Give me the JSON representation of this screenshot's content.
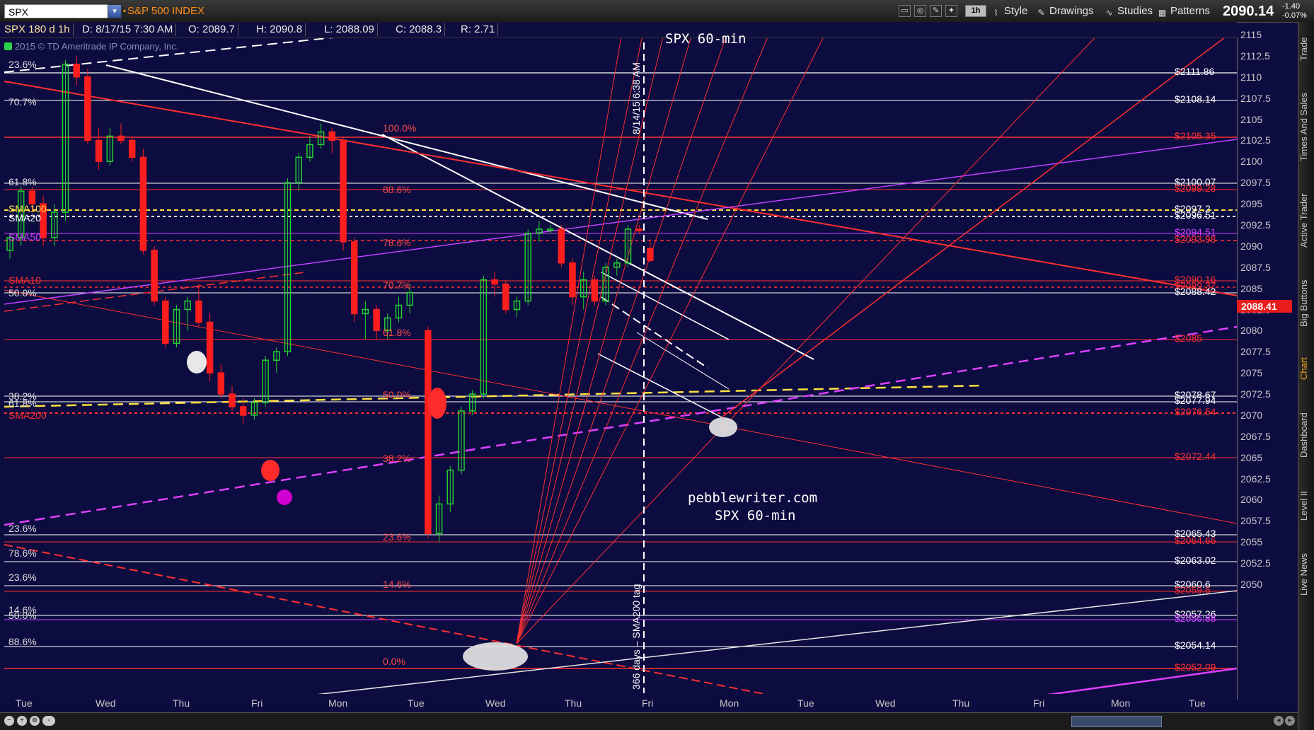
{
  "toolbar": {
    "symbol": "SPX",
    "index_name": "S&P 500 INDEX",
    "timeframe": "1h",
    "style_label": "Style",
    "drawings_label": "Drawings",
    "studies_label": "Studies",
    "patterns_label": "Patterns",
    "last_price": "2090.14",
    "net_change": "-1.40",
    "pct_change": "-0.07%"
  },
  "infobar": {
    "title": "SPX 180 d 1h",
    "date": "D: 8/17/15 7:30 AM",
    "open": "O: 2089.7",
    "high": "H: 2090.8",
    "low": "L: 2088.09",
    "close": "C: 2088.3",
    "range": "R: 2.71"
  },
  "copyright": "2015 © TD Ameritrade IP Company, Inc.",
  "price_axis": {
    "ticks": [
      "2115",
      "2112.5",
      "2110",
      "2107.5",
      "2105",
      "2102.5",
      "2100",
      "2097.5",
      "2095",
      "2092.5",
      "2090",
      "2087.5",
      "2085",
      "2082.5",
      "2080",
      "2077.5",
      "2075",
      "2072.5",
      "2070",
      "2067.5",
      "2065",
      "2062.5",
      "2060",
      "2057.5",
      "2055",
      "2052.5",
      "2050"
    ],
    "current_price": "2088.41"
  },
  "levels": [
    {
      "label": "$2111.86",
      "color": "#ffffff"
    },
    {
      "label": "$2108.14",
      "color": "#ffffff"
    },
    {
      "label": "$2105.35",
      "color": "#ff3030"
    },
    {
      "label": "$2100.07",
      "color": "#ffffff"
    },
    {
      "label": "$2099.28",
      "color": "#ff3030"
    },
    {
      "label": "$2097.2",
      "color": "#ffffff"
    },
    {
      "label": "$2096.51",
      "color": "#ffffff"
    },
    {
      "label": "$2094.51",
      "color": "#d040ff"
    },
    {
      "label": "$2093.98",
      "color": "#ff3030"
    },
    {
      "label": "$2090.16",
      "color": "#ff3030"
    },
    {
      "label": "$2089.37",
      "color": "#ff3030"
    },
    {
      "label": "$2088.42",
      "color": "#ffffff"
    },
    {
      "label": "$2085",
      "color": "#ff3030"
    },
    {
      "label": "$2078.67",
      "color": "#ffffff"
    },
    {
      "label": "$2077.94",
      "color": "#ffffff"
    },
    {
      "label": "$2076.54",
      "color": "#ff3030"
    },
    {
      "label": "$2072.44",
      "color": "#ff3030"
    },
    {
      "label": "$2065.43",
      "color": "#ffffff"
    },
    {
      "label": "$2064.66",
      "color": "#ff3030"
    },
    {
      "label": "$2063.02",
      "color": "#ffffff"
    },
    {
      "label": "$2060.6",
      "color": "#ffffff"
    },
    {
      "label": "$2059.6",
      "color": "#ff3030"
    },
    {
      "label": "$2057.26",
      "color": "#ffffff"
    },
    {
      "label": "$2056.88",
      "color": "#d040ff"
    },
    {
      "label": "$2054.14",
      "color": "#ffffff"
    },
    {
      "label": "$2052.09",
      "color": "#ff3030"
    }
  ],
  "fib_left": [
    "23.6%",
    "70.7%",
    "61.8%",
    "50.0%",
    "38.2%",
    "61.8%",
    "23.6%",
    "78.6%",
    "23.6%",
    "14.6%",
    "50.0%",
    "88.6%"
  ],
  "fib_mid": [
    "100.0%",
    "88.6%",
    "78.6%",
    "70.7%",
    "61.8%",
    "50.0%",
    "38.2%",
    "23.6%",
    "14.6%",
    "0.0%"
  ],
  "sma_labels": [
    {
      "text": "SMA100",
      "color": "#ffe040"
    },
    {
      "text": "SMA20",
      "color": "#ffffff"
    },
    {
      "text": "SMA50",
      "color": "#d040ff"
    },
    {
      "text": "SMA10",
      "color": "#ff3030"
    },
    {
      "text": "SMA200",
      "color": "#ff3030"
    }
  ],
  "annotations": {
    "vertical_top": "8/14/15 6:38 AM",
    "vertical_bottom": "366 days – SMA200 tag",
    "watermark_site": "pebblewriter.com",
    "watermark_title": "SPX 60-min",
    "watermark_top": "SPX 60-min"
  },
  "time_axis": [
    "Tue",
    "Wed",
    "Thu",
    "Fri",
    "Mon",
    "Tue",
    "Wed",
    "Thu",
    "Fri",
    "Mon",
    "Tue",
    "Wed",
    "Thu",
    "Fri",
    "Mon",
    "Tue"
  ],
  "sidebar_tabs": [
    "Trade",
    "Times And Sales",
    "Active Trader",
    "Big Buttons",
    "Chart",
    "Dashboard",
    "Level II",
    "Live News"
  ],
  "chart_data": {
    "type": "candlestick",
    "title": "SPX 180 d 1h",
    "ylim": [
      2050,
      2116
    ],
    "candles": [
      {
        "o": 2089.5,
        "h": 2091.5,
        "l": 2088.5,
        "c": 2091
      },
      {
        "o": 2091,
        "h": 2097,
        "l": 2090,
        "c": 2096.5
      },
      {
        "o": 2096.5,
        "h": 2097,
        "l": 2094,
        "c": 2095
      },
      {
        "o": 2095,
        "h": 2096,
        "l": 2090,
        "c": 2091
      },
      {
        "o": 2091,
        "h": 2095,
        "l": 2090,
        "c": 2094
      },
      {
        "o": 2094,
        "h": 2112,
        "l": 2093,
        "c": 2111.5
      },
      {
        "o": 2111.5,
        "h": 2112.5,
        "l": 2109,
        "c": 2110
      },
      {
        "o": 2110,
        "h": 2111,
        "l": 2102,
        "c": 2102.5
      },
      {
        "o": 2102.5,
        "h": 2104,
        "l": 2099,
        "c": 2100
      },
      {
        "o": 2100,
        "h": 2104,
        "l": 2099.5,
        "c": 2103
      },
      {
        "o": 2103,
        "h": 2104.5,
        "l": 2102,
        "c": 2102.5
      },
      {
        "o": 2102.5,
        "h": 2103,
        "l": 2100,
        "c": 2100.5
      },
      {
        "o": 2100.5,
        "h": 2101.5,
        "l": 2089,
        "c": 2089.5
      },
      {
        "o": 2089.5,
        "h": 2090,
        "l": 2083,
        "c": 2083.5
      },
      {
        "o": 2083.5,
        "h": 2084,
        "l": 2078,
        "c": 2078.5
      },
      {
        "o": 2078.5,
        "h": 2083,
        "l": 2078,
        "c": 2082.5
      },
      {
        "o": 2082.5,
        "h": 2084,
        "l": 2080,
        "c": 2083.5
      },
      {
        "o": 2083.5,
        "h": 2085.5,
        "l": 2080.5,
        "c": 2081
      },
      {
        "o": 2081,
        "h": 2082,
        "l": 2074,
        "c": 2075
      },
      {
        "o": 2075,
        "h": 2076,
        "l": 2072,
        "c": 2072.5
      },
      {
        "o": 2072.5,
        "h": 2073.5,
        "l": 2070.5,
        "c": 2071
      },
      {
        "o": 2071,
        "h": 2072,
        "l": 2069,
        "c": 2070
      },
      {
        "o": 2070,
        "h": 2072,
        "l": 2069.5,
        "c": 2071.5
      },
      {
        "o": 2071.5,
        "h": 2077,
        "l": 2071,
        "c": 2076.5
      },
      {
        "o": 2076.5,
        "h": 2078,
        "l": 2075,
        "c": 2077.5
      },
      {
        "o": 2077.5,
        "h": 2098,
        "l": 2077,
        "c": 2097.5
      },
      {
        "o": 2097.5,
        "h": 2101,
        "l": 2096.5,
        "c": 2100.5
      },
      {
        "o": 2100.5,
        "h": 2103,
        "l": 2100,
        "c": 2102
      },
      {
        "o": 2102,
        "h": 2104.5,
        "l": 2101.5,
        "c": 2103.5
      },
      {
        "o": 2103.5,
        "h": 2104,
        "l": 2101,
        "c": 2102.5
      },
      {
        "o": 2102.5,
        "h": 2103,
        "l": 2089.5,
        "c": 2090.5
      },
      {
        "o": 2090.5,
        "h": 2091,
        "l": 2081,
        "c": 2082
      },
      {
        "o": 2082,
        "h": 2083.5,
        "l": 2079,
        "c": 2082.5
      },
      {
        "o": 2082.5,
        "h": 2083,
        "l": 2079,
        "c": 2080
      },
      {
        "o": 2080,
        "h": 2082,
        "l": 2079,
        "c": 2081.5
      },
      {
        "o": 2081.5,
        "h": 2084,
        "l": 2081,
        "c": 2083
      },
      {
        "o": 2083,
        "h": 2085.5,
        "l": 2082,
        "c": 2084.5
      },
      {
        "o": 2080,
        "h": 2080.5,
        "l": 2055.5,
        "c": 2056
      },
      {
        "o": 2056,
        "h": 2060.5,
        "l": 2055,
        "c": 2059.5
      },
      {
        "o": 2059.5,
        "h": 2064,
        "l": 2058.5,
        "c": 2063.5
      },
      {
        "o": 2063.5,
        "h": 2071,
        "l": 2063,
        "c": 2070.5
      },
      {
        "o": 2070.5,
        "h": 2073,
        "l": 2070,
        "c": 2072.5
      },
      {
        "o": 2072.5,
        "h": 2086.5,
        "l": 2072,
        "c": 2086
      },
      {
        "o": 2086,
        "h": 2087,
        "l": 2084,
        "c": 2085.5
      },
      {
        "o": 2085.5,
        "h": 2086,
        "l": 2082,
        "c": 2082.5
      },
      {
        "o": 2082.5,
        "h": 2084,
        "l": 2081.5,
        "c": 2083.5
      },
      {
        "o": 2083.5,
        "h": 2092,
        "l": 2083,
        "c": 2091.5
      },
      {
        "o": 2091.5,
        "h": 2093,
        "l": 2090.5,
        "c": 2092
      },
      {
        "o": 2092,
        "h": 2092.5,
        "l": 2091.5,
        "c": 2092
      },
      {
        "o": 2092,
        "h": 2092.5,
        "l": 2087.5,
        "c": 2088
      },
      {
        "o": 2088,
        "h": 2088.5,
        "l": 2083,
        "c": 2084
      },
      {
        "o": 2084,
        "h": 2087,
        "l": 2082.5,
        "c": 2086
      },
      {
        "o": 2086,
        "h": 2086.5,
        "l": 2083,
        "c": 2083.5
      },
      {
        "o": 2083.5,
        "h": 2088,
        "l": 2083,
        "c": 2087.5
      },
      {
        "o": 2087.5,
        "h": 2088.5,
        "l": 2086.5,
        "c": 2088
      },
      {
        "o": 2088,
        "h": 2092.5,
        "l": 2087.5,
        "c": 2092
      },
      {
        "o": 2092,
        "h": 2092.5,
        "l": 2091.5,
        "c": 2091.8
      },
      {
        "o": 2089.7,
        "h": 2090.8,
        "l": 2088.09,
        "c": 2088.3
      }
    ]
  }
}
